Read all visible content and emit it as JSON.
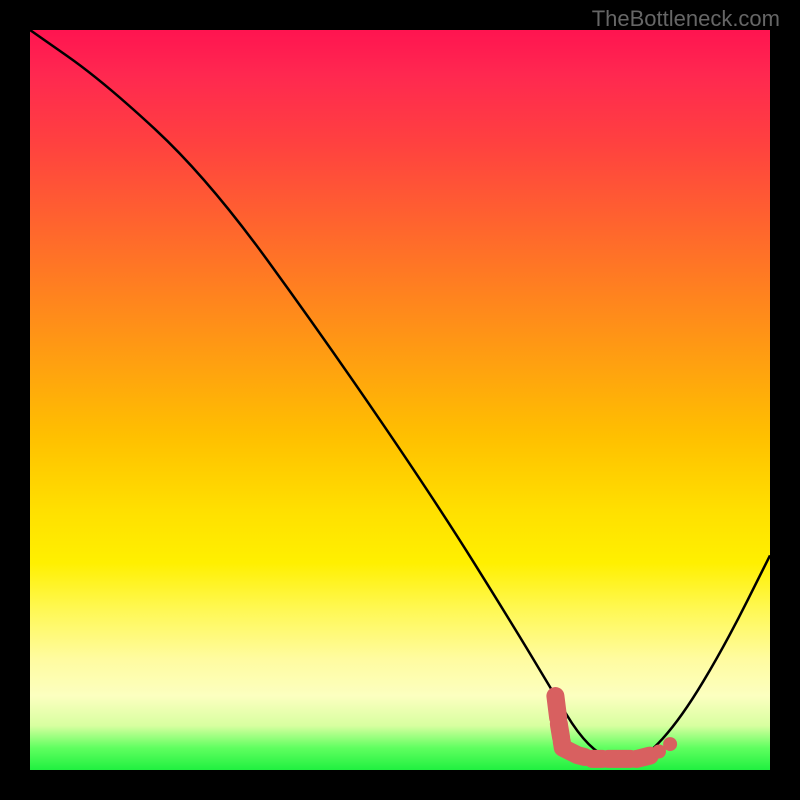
{
  "watermark": "TheBottleneck.com",
  "chart_data": {
    "type": "line",
    "title": "",
    "xlabel": "",
    "ylabel": "",
    "xlim": [
      0,
      100
    ],
    "ylim": [
      0,
      100
    ],
    "series": [
      {
        "name": "bottleneck-curve",
        "x": [
          0,
          10,
          24,
          40,
          55,
          65,
          71,
          74,
          77,
          80,
          83,
          88,
          94,
          100
        ],
        "values": [
          100,
          93,
          80,
          58,
          36,
          20,
          10,
          5,
          2,
          1,
          1.5,
          7,
          17,
          29
        ]
      }
    ],
    "highlight_region": {
      "name": "optimal-zone",
      "color": "#d86060",
      "points": [
        {
          "x": 71,
          "y": 10
        },
        {
          "x": 71.5,
          "y": 6
        },
        {
          "x": 72,
          "y": 3
        },
        {
          "x": 74,
          "y": 2
        },
        {
          "x": 76,
          "y": 1.5
        },
        {
          "x": 78,
          "y": 1.5
        },
        {
          "x": 80,
          "y": 1.5
        },
        {
          "x": 82,
          "y": 1.5
        },
        {
          "x": 84,
          "y": 2
        }
      ]
    },
    "gradient_meaning": "red (top) = high bottleneck, green (bottom) = low bottleneck"
  }
}
